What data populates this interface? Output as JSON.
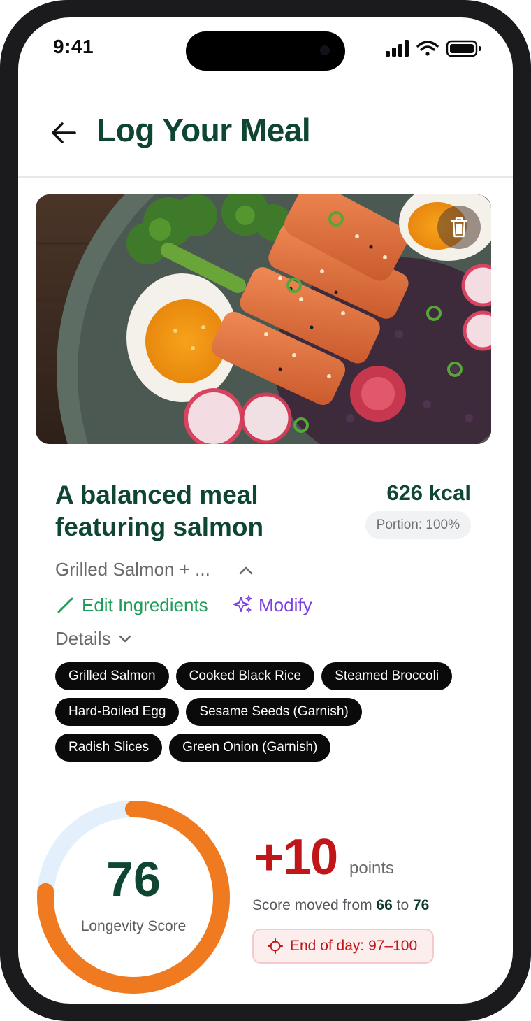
{
  "status_bar": {
    "time": "9:41"
  },
  "header": {
    "title": "Log Your Meal",
    "back_icon": "arrow-left-icon"
  },
  "photo": {
    "description_icon": "meal-photo",
    "delete_icon": "trash-icon"
  },
  "meal": {
    "title": "A balanced meal featuring salmon",
    "calories": "626 kcal",
    "portion": "Portion: 100%",
    "ingredients_summary": "Grilled Salmon + ...",
    "edit_label": "Edit Ingredients",
    "modify_label": "Modify",
    "details_label": "Details",
    "ingredients": [
      [
        "Grilled Salmon",
        "Cooked Black Rice",
        "Steamed Broccoli"
      ],
      [
        "Hard-Boiled Egg",
        "Sesame Seeds (Garnish)"
      ],
      [
        "Radish Slices",
        "Green Onion (Garnish)"
      ]
    ]
  },
  "score": {
    "value": "76",
    "label": "Longevity Score",
    "progress_fraction": 0.76,
    "delta": "+10",
    "delta_unit": "points",
    "moved_prefix": "Score moved from",
    "moved_from": "66",
    "moved_to_word": "to",
    "moved_to": "76",
    "end_of_day": "End of day: 97–100"
  },
  "colors": {
    "brand_green": "#0f4631",
    "accent_green": "#1f9c5a",
    "accent_purple": "#7a3fe0",
    "score_orange": "#f07a1f",
    "ring_track": "#e3f0fb",
    "delta_red": "#c0161a"
  }
}
